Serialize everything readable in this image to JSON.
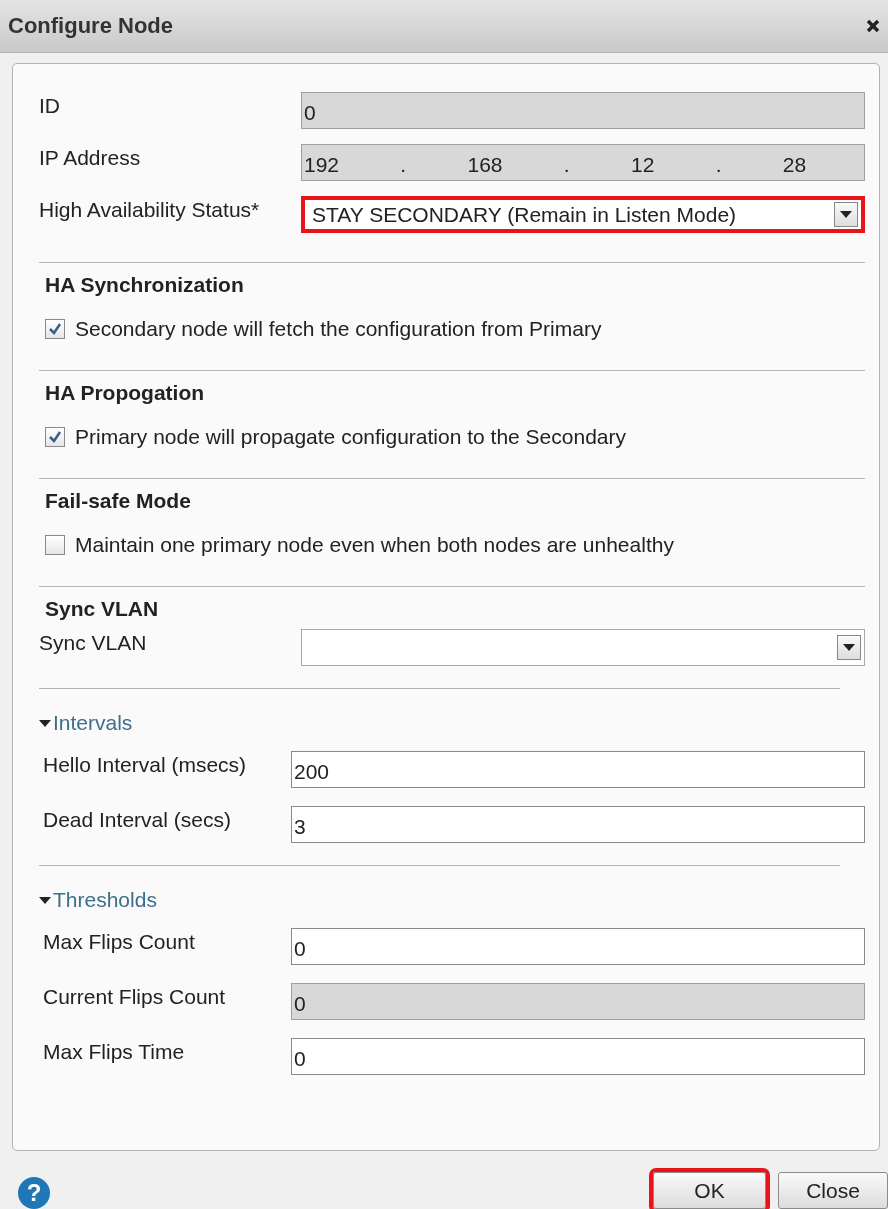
{
  "window": {
    "title": "Configure Node"
  },
  "fields": [
    {
      "kind": "text",
      "label": "ID",
      "value": "0",
      "disabled": true
    },
    {
      "kind": "ip",
      "label": "IP Address",
      "parts": [
        "192",
        ".",
        "168",
        ".",
        "12",
        ".",
        "28"
      ],
      "disabled": true
    },
    {
      "kind": "dropdown",
      "label": "High Availability Status*",
      "value": "STAY SECONDARY (Remain in Listen Mode)",
      "highlighted": true
    }
  ],
  "sections": [
    {
      "kind": "checkbox",
      "title": "HA Synchronization",
      "label": "Secondary node will fetch the configuration from Primary",
      "checked": true
    },
    {
      "kind": "checkbox",
      "title": "HA Propogation",
      "label": "Primary node will propagate configuration to the Secondary",
      "checked": true
    },
    {
      "kind": "checkbox",
      "title": "Fail-safe Mode",
      "label": "Maintain one primary node even when both nodes are unhealthy",
      "checked": false
    },
    {
      "kind": "fields",
      "title": "Sync VLAN",
      "fields": [
        {
          "kind": "dropdown",
          "label": "Sync VLAN",
          "highlighted": false
        }
      ]
    },
    {
      "kind": "group",
      "title": "Intervals",
      "expanded": true,
      "fields": [
        {
          "kind": "text",
          "label": "Hello Interval (msecs)",
          "value": "200",
          "disabled": false
        },
        {
          "kind": "text",
          "label": "Dead Interval (secs)",
          "value": "3",
          "disabled": false
        }
      ]
    },
    {
      "kind": "group",
      "title": "Thresholds",
      "expanded": true,
      "fields": [
        {
          "kind": "text",
          "label": "Max Flips Count",
          "value": "0",
          "disabled": false
        },
        {
          "kind": "text",
          "label": "Current Flips Count",
          "value": "0",
          "disabled": true
        },
        {
          "kind": "text",
          "label": "Max Flips Time",
          "value": "0",
          "disabled": false
        }
      ]
    }
  ],
  "footer": {
    "help": "?",
    "buttons": [
      {
        "label": "OK",
        "highlighted": true
      },
      {
        "label": "Close",
        "highlighted": false
      }
    ]
  }
}
